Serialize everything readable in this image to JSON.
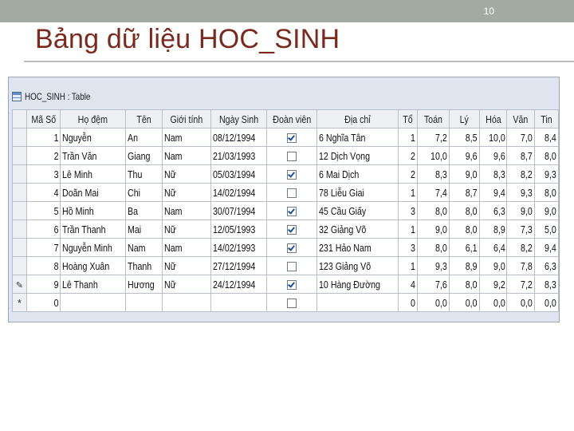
{
  "slide": {
    "number": "10",
    "title": "Bảng dữ liệu HOC_SINH"
  },
  "window": {
    "title": "HOC_SINH : Table",
    "icon": "table-icon"
  },
  "table": {
    "headers": [
      "Mã Số",
      "Họ đệm",
      "Tên",
      "Giới tính",
      "Ngày Sinh",
      "Đoàn viên",
      "Địa chỉ",
      "Tổ",
      "Toán",
      "Lý",
      "Hóa",
      "Văn",
      "Tin"
    ],
    "rows": [
      [
        "1",
        "Nguyễn",
        "An",
        "Nam",
        "08/12/1994",
        true,
        "6 Nghĩa Tân",
        "1",
        "7,2",
        "8,5",
        "10,0",
        "7,0",
        "8,4"
      ],
      [
        "2",
        "Trần Văn",
        "Giang",
        "Nam",
        "21/03/1993",
        false,
        "12 Dịch Vọng",
        "2",
        "10,0",
        "9,6",
        "9,6",
        "8,7",
        "8,0"
      ],
      [
        "3",
        "Lê Minh",
        "Thu",
        "Nữ",
        "05/03/1994",
        true,
        "6 Mai Dịch",
        "2",
        "8,3",
        "9,0",
        "8,3",
        "8,2",
        "9,3"
      ],
      [
        "4",
        "Doãn Mai",
        "Chi",
        "Nữ",
        "14/02/1994",
        false,
        "78 Liễu Giai",
        "1",
        "7,4",
        "8,7",
        "9,4",
        "9,3",
        "8,0"
      ],
      [
        "5",
        "Hồ Minh",
        "Ba",
        "Nam",
        "30/07/1994",
        true,
        "45 Cầu Giấy",
        "3",
        "8,0",
        "8,0",
        "6,3",
        "9,0",
        "9,0"
      ],
      [
        "6",
        "Trần Thanh",
        "Mai",
        "Nữ",
        "12/05/1993",
        true,
        "32 Giảng Võ",
        "1",
        "9,0",
        "8,0",
        "8,9",
        "7,3",
        "5,0"
      ],
      [
        "7",
        "Nguyễn Minh",
        "Nam",
        "Nam",
        "14/02/1993",
        true,
        "231 Hảo Nam",
        "3",
        "8,0",
        "6,1",
        "6,4",
        "8,2",
        "9,4"
      ],
      [
        "8",
        "Hoàng Xuân",
        "Thanh",
        "Nữ",
        "27/12/1994",
        false,
        "123 Giảng Võ",
        "1",
        "9,3",
        "8,9",
        "9,0",
        "7,8",
        "6,3"
      ],
      [
        "9",
        "Lê Thanh",
        "Hương",
        "Nữ",
        "24/12/1994",
        true,
        "10 Hàng Đường",
        "4",
        "7,6",
        "8,0",
        "9,2",
        "7,2",
        "8,3"
      ]
    ],
    "new_row": [
      "0",
      "",
      "",
      "",
      "",
      false,
      "",
      "0",
      "0,0",
      "0,0",
      "0,0",
      "0,0",
      "0,0"
    ]
  }
}
